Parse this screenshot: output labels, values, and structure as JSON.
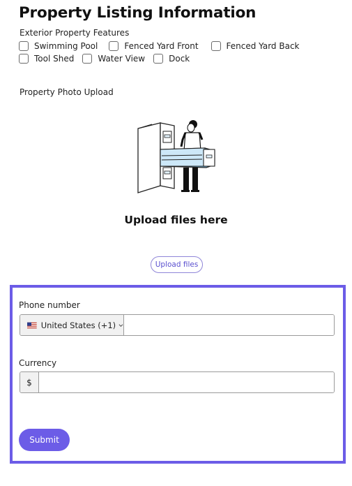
{
  "page": {
    "title": "Property Listing Information"
  },
  "features": {
    "label": "Exterior Property Features",
    "options": [
      {
        "label": "Swimming Pool",
        "checked": false
      },
      {
        "label": "Fenced Yard Front",
        "checked": false
      },
      {
        "label": "Fenced Yard Back",
        "checked": false
      },
      {
        "label": "Tool Shed",
        "checked": false
      },
      {
        "label": "Water View",
        "checked": false
      },
      {
        "label": "Dock",
        "checked": false
      }
    ]
  },
  "upload": {
    "label": "Property Photo Upload",
    "heading": "Upload files here",
    "button_label": "Upload files",
    "illustration_icon": "filing-cabinet-person-icon"
  },
  "phone": {
    "label": "Phone number",
    "country": "United States (+1)",
    "flag_icon": "us-flag-icon",
    "value": ""
  },
  "currency": {
    "label": "Currency",
    "symbol": "$",
    "value": ""
  },
  "submit": {
    "label": "Submit"
  },
  "colors": {
    "accent": "#6c5ce7",
    "panel_border": "#6c5ce7",
    "input_border": "#9a9a9a"
  }
}
